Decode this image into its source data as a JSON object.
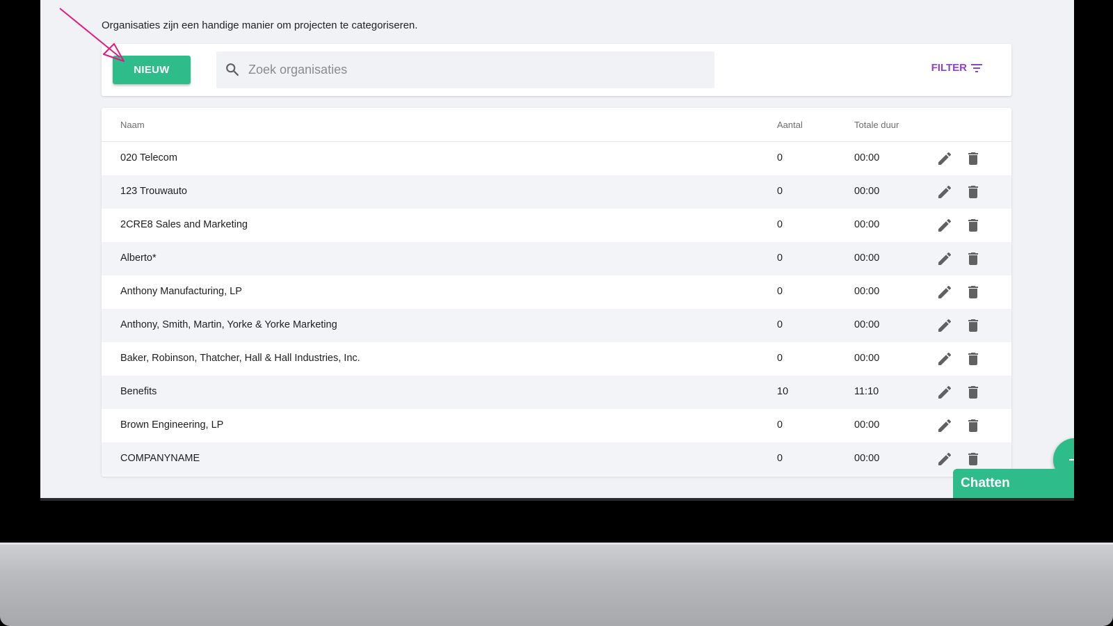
{
  "page": {
    "intro_text": "Organisaties zijn een handige manier om projecten te categoriseren."
  },
  "toolbar": {
    "new_button_label": "NIEUW",
    "search_placeholder": "Zoek organisaties",
    "search_value": "",
    "filter_label": "FILTER"
  },
  "table": {
    "columns": [
      "Naam",
      "Aantal",
      "Totale duur"
    ],
    "rows": [
      {
        "name": "020 Telecom",
        "count": "0",
        "duration": "00:00"
      },
      {
        "name": "123 Trouwauto",
        "count": "0",
        "duration": "00:00"
      },
      {
        "name": "2CRE8 Sales and Marketing",
        "count": "0",
        "duration": "00:00"
      },
      {
        "name": "Alberto*",
        "count": "0",
        "duration": "00:00"
      },
      {
        "name": "Anthony Manufacturing, LP",
        "count": "0",
        "duration": "00:00"
      },
      {
        "name": "Anthony, Smith, Martin, Yorke & Yorke Marketing",
        "count": "0",
        "duration": "00:00"
      },
      {
        "name": "Baker, Robinson, Thatcher, Hall & Hall Industries, Inc.",
        "count": "0",
        "duration": "00:00"
      },
      {
        "name": "Benefits",
        "count": "10",
        "duration": "11:10"
      },
      {
        "name": "Brown Engineering, LP",
        "count": "0",
        "duration": "00:00"
      },
      {
        "name": "COMPANYNAME",
        "count": "0",
        "duration": "00:00"
      }
    ]
  },
  "chat": {
    "label": "Chatten"
  },
  "colors": {
    "accent": "#2ebd8a",
    "filter": "#8e44c4",
    "annotation_arrow": "#e8177f"
  },
  "icons": {
    "search": "search-icon",
    "filter": "filter-icon",
    "edit": "pencil-icon",
    "delete": "trash-icon",
    "add": "plus-icon",
    "chat_toggle": "chevron-up-icon"
  }
}
